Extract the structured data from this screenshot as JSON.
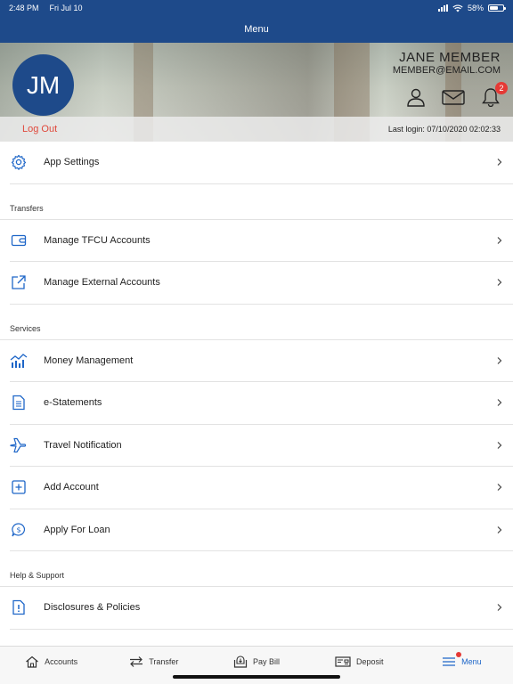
{
  "status": {
    "time": "2:48 PM",
    "date": "Fri Jul 10",
    "battery": "58%"
  },
  "nav": {
    "title": "Menu"
  },
  "profile": {
    "initials": "JM",
    "name": "JANE MEMBER",
    "email": "MEMBER@EMAIL.COM",
    "notification_count": "2",
    "logout_label": "Log Out",
    "last_login": "Last login: 07/10/2020 02:02:33"
  },
  "menu": {
    "app_settings": "App Settings",
    "transfers_header": "Transfers",
    "manage_tfcu": "Manage TFCU Accounts",
    "manage_external": "Manage External Accounts",
    "services_header": "Services",
    "money_management": "Money Management",
    "e_statements": "e-Statements",
    "travel_notification": "Travel Notification",
    "add_account": "Add Account",
    "apply_for_loan": "Apply For Loan",
    "help_header": "Help & Support",
    "disclosures": "Disclosures & Policies"
  },
  "tabs": {
    "accounts": "Accounts",
    "transfer": "Transfer",
    "pay_bill": "Pay Bill",
    "deposit": "Deposit",
    "menu": "Menu"
  },
  "colors": {
    "brand": "#1e4a8a",
    "accent": "#1e66c8",
    "alert": "#e53935",
    "logout": "#e0483b"
  }
}
